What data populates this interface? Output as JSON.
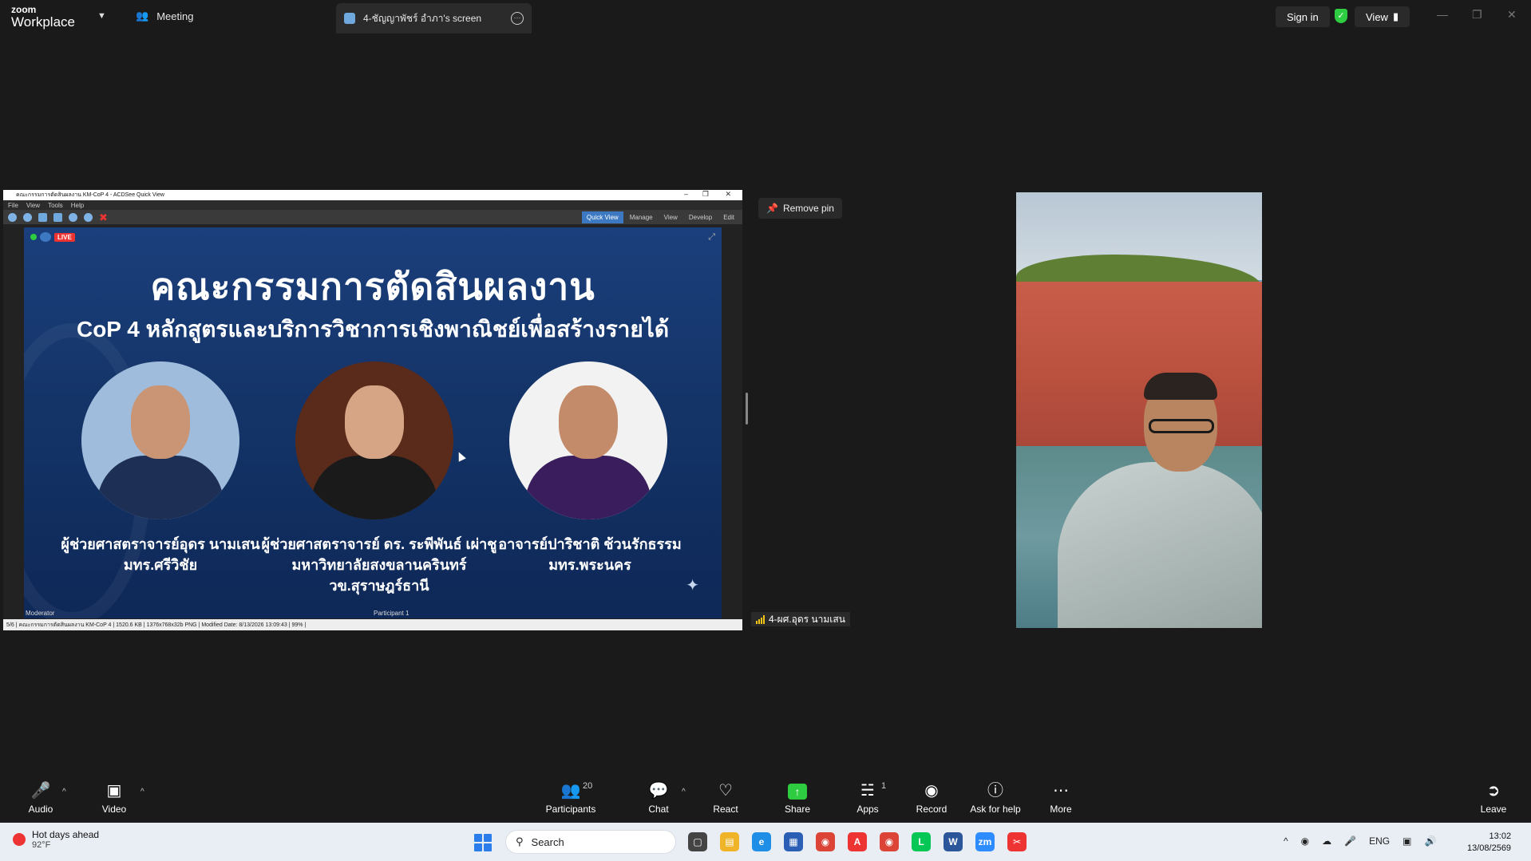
{
  "titlebar": {
    "logo_top": "zoom",
    "logo_bottom": "Workplace",
    "meeting_label": "Meeting",
    "screen_tab_label": "4-ชัญญาพัชร์ อำภา's screen",
    "signin_label": "Sign in",
    "view_label": "View"
  },
  "shared_window": {
    "title": "คณะกรรมการตัดสินผลงาน KM-CoP 4 - ACDSee Quick View",
    "menu": [
      "File",
      "View",
      "Tools",
      "Help"
    ],
    "modes": [
      "Quick View",
      "Manage",
      "View",
      "Develop",
      "Edit"
    ],
    "live_tag": "LIVE",
    "statusbar": "5/6 | คณะกรรมการตัดสินผลงาน KM-CoP 4 | 1520.6 KB | 1376x768x32b PNG | Modified Date: 8/13/2026 13:09:43 | 99% |"
  },
  "slide": {
    "title": "คณะกรรมการตัดสินผลงาน",
    "subtitle": "CoP 4 หลักสูตรและบริการวิชาการเชิงพาณิชย์เพื่อสร้างรายได้",
    "people": [
      {
        "line1": "ผู้ช่วยศาสตราจารย์อุดร นามเสน",
        "line2": "มทร.ศรีวิชัย"
      },
      {
        "line1": "ผู้ช่วยศาสตราจารย์ ดร. ระพีพันธ์ เผ่าชู",
        "line2": "มหาวิทยาลัยสงขลานครินทร์ วข.สุราษฎร์ธานี"
      },
      {
        "line1": "อาจารย์ปาริชาติ ช้วนรักธรรม",
        "line2": "มทร.พระนคร"
      }
    ],
    "caption_left": "Moderator",
    "caption_mid": "Participant 1"
  },
  "remove_pin_label": "Remove pin",
  "participant_name": "4-ผศ.อุดร นามเสน",
  "toolbar": {
    "audio": "Audio",
    "video": "Video",
    "participants": "Participants",
    "participants_count": "20",
    "chat": "Chat",
    "react": "React",
    "share": "Share",
    "apps": "Apps",
    "apps_count": "1",
    "record": "Record",
    "ask": "Ask for help",
    "more": "More",
    "leave": "Leave"
  },
  "taskbar": {
    "weather_title": "Hot days ahead",
    "weather_temp": "92°F",
    "search_placeholder": "Search",
    "lang": "ENG",
    "time": "13:02",
    "date": "13/08/2569"
  },
  "colors": {
    "zoom_bg": "#1a1a1a",
    "share_green": "#2ecc40",
    "slide_blue": "#143468",
    "taskbar": "#e9eef5"
  }
}
